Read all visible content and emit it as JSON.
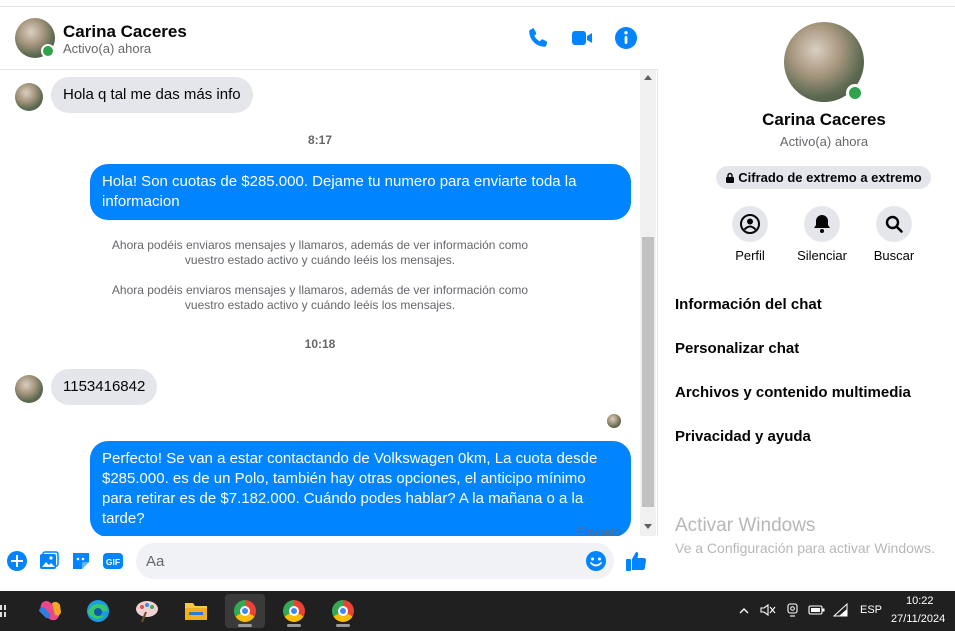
{
  "header": {
    "name": "Carina Caceres",
    "status": "Activo(a) ahora"
  },
  "messages": {
    "m1": "Hola q tal me das más info",
    "time1": "8:17",
    "m2": "Hola! Son cuotas de $285.000. Dejame tu numero para enviarte toda la informacion",
    "sys1": "Ahora podéis enviaros mensajes y llamaros, además de ver información como vuestro estado activo y cuándo leéis los mensajes.",
    "sys2": "Ahora podéis enviaros mensajes y llamaros, además de ver información como vuestro estado activo y cuándo leéis los mensajes.",
    "time2": "10:18",
    "m3": "1153416842",
    "m4": "Perfecto!  Se van a estar contactando de Volkswagen 0km, La cuota desde $285.000. es de un Polo, también hay otras opciones, el anticipo mínimo para retirar es de $7.182.000. Cuándo podes hablar? A la mañana o a la tarde?",
    "sent_label": "Enviado"
  },
  "composer": {
    "placeholder": "Aa",
    "gif_label": "GIF"
  },
  "info_panel": {
    "name": "Carina Caceres",
    "status": "Activo(a) ahora",
    "e2e": "Cifrado de extremo a extremo",
    "actions": [
      "Perfil",
      "Silenciar",
      "Buscar"
    ],
    "menu": [
      "Información del chat",
      "Personalizar chat",
      "Archivos y contenido multimedia",
      "Privacidad y ayuda"
    ]
  },
  "watermark": {
    "title": "Activar Windows",
    "subtitle": "Ve a Configuración para activar Windows."
  },
  "taskbar": {
    "language": "ESP",
    "time": "10:22",
    "date": "27/11/2024"
  },
  "colors": {
    "accent": "#0084ff",
    "online": "#31a24c",
    "bubble_in": "#e4e6eb"
  }
}
